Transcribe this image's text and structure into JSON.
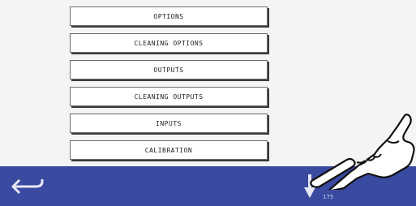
{
  "menu": {
    "items": [
      {
        "label": "OPTIONS"
      },
      {
        "label": "CLEANING OPTIONS"
      },
      {
        "label": "OUTPUTS"
      },
      {
        "label": "CLEANING OUTPUTS"
      },
      {
        "label": "INPUTS"
      },
      {
        "label": "CALIBRATION"
      }
    ]
  },
  "bottom_bar": {
    "page_number": "175",
    "back_icon": "back-arrow-icon",
    "down_icon": "down-arrow-icon",
    "color": "#3a4aa0"
  },
  "overlay": {
    "icon": "pointing-hand-icon"
  }
}
